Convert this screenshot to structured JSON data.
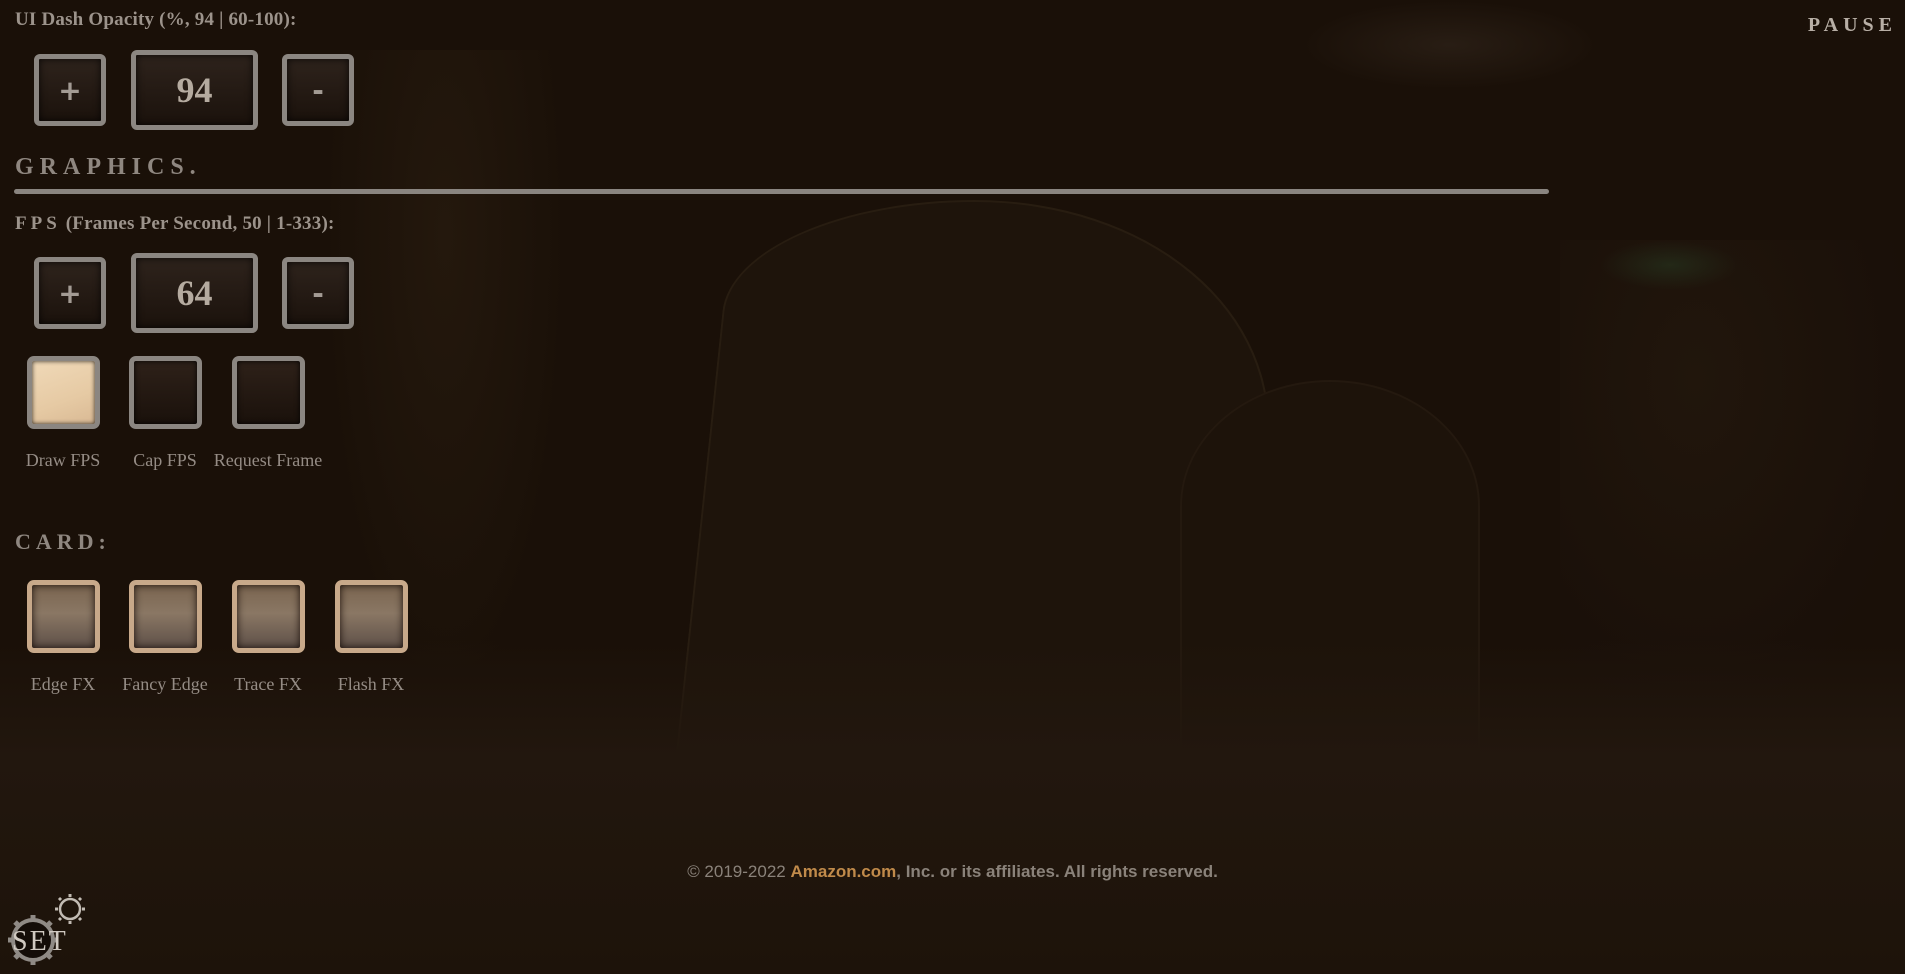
{
  "opacity": {
    "label": "UI Dash Opacity (%, 94 | 60-100):",
    "plus_label": "+",
    "value": "94",
    "minus_label": "-"
  },
  "graphics": {
    "section_title": "GRAPHICS.",
    "fps": {
      "label_prefix": "FPS",
      "label_rest": " (Frames Per Second, 50 | 1-333):",
      "plus_label": "+",
      "value": "64",
      "minus_label": "-"
    },
    "toggles": [
      {
        "label": "Draw FPS",
        "checked": true
      },
      {
        "label": "Cap FPS",
        "checked": false
      },
      {
        "label": "Request Frame",
        "checked": false
      }
    ]
  },
  "card": {
    "section_title": "CARD:",
    "toggles": [
      {
        "label": "Edge FX",
        "checked": true
      },
      {
        "label": "Fancy Edge",
        "checked": true
      },
      {
        "label": "Trace FX",
        "checked": true
      },
      {
        "label": "Flash FX",
        "checked": true
      }
    ]
  },
  "pause": {
    "label": "PAUSE"
  },
  "footer": {
    "prefix": "© 2019-2022 ",
    "brand": "Amazon.com",
    "suffix": ", Inc. or its affiliates. All rights reserved.",
    "brand_color": "#c08a4a"
  },
  "logo": {
    "text": "SET",
    "icon": "gear-icon"
  }
}
